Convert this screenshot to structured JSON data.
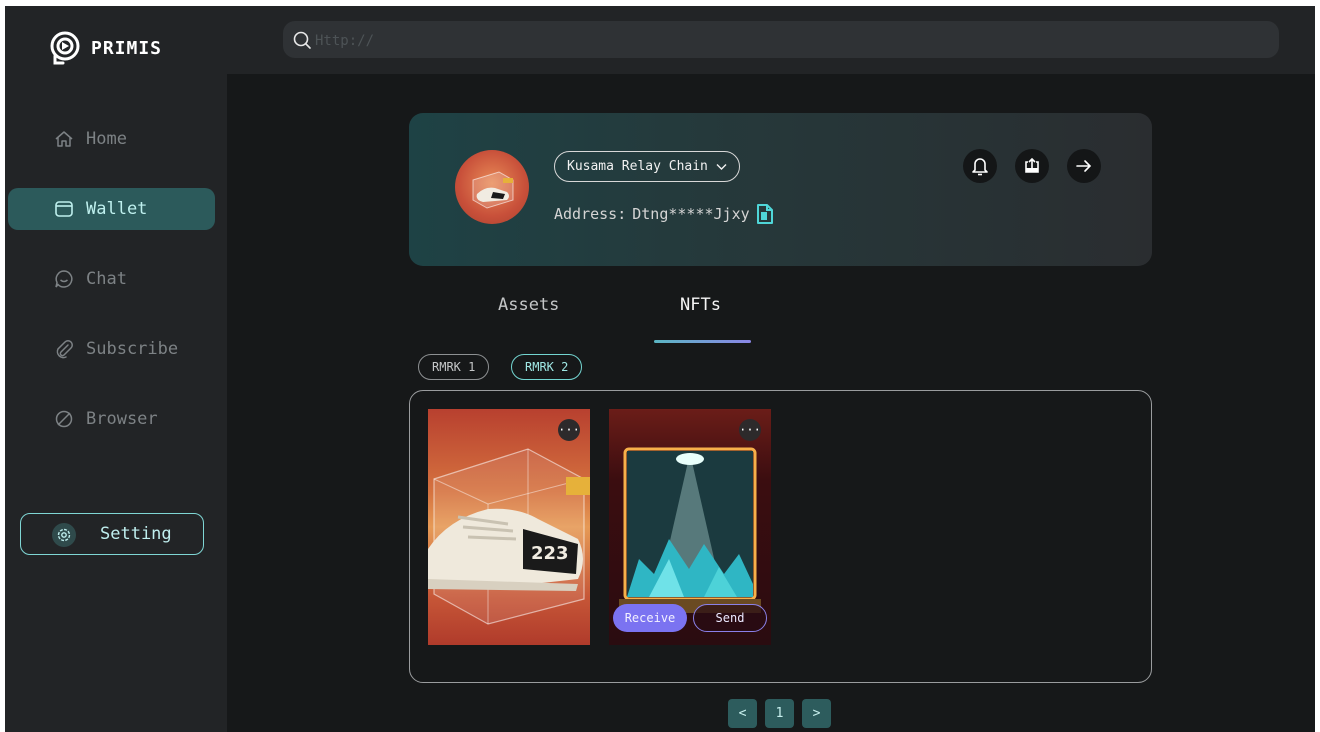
{
  "app": {
    "logo_text": "PRIMIS"
  },
  "search": {
    "placeholder": "Http://",
    "value": ""
  },
  "sidebar": {
    "items": [
      {
        "label": "Home",
        "icon": "home-icon",
        "active": false
      },
      {
        "label": "Wallet",
        "icon": "wallet-icon",
        "active": true
      },
      {
        "label": "Chat",
        "icon": "chat-icon",
        "active": false
      },
      {
        "label": "Subscribe",
        "icon": "paperclip-icon",
        "active": false
      },
      {
        "label": "Browser",
        "icon": "browser-icon",
        "active": false
      }
    ],
    "setting_label": "Setting"
  },
  "account": {
    "chain": "Kusama Relay Chain",
    "address_label": "Address:",
    "address": "Dtng*****Jjxy"
  },
  "tabs": [
    {
      "label": "Assets",
      "active": false
    },
    {
      "label": "NFTs",
      "active": true
    }
  ],
  "filters": [
    {
      "label": "RMRK 1",
      "active": false
    },
    {
      "label": "RMRK 2",
      "active": true
    }
  ],
  "nfts": [
    {
      "more": "···",
      "actions": []
    },
    {
      "more": "···",
      "actions": [
        "Receive",
        "Send"
      ]
    }
  ],
  "pagination": {
    "prev": "<",
    "current": "1",
    "next": ">"
  },
  "colors": {
    "accent": "#2c5a5b",
    "accent_text": "#bff0ee",
    "receive": "#7b73f1",
    "background": "#161819",
    "sidebar": "#222426"
  }
}
